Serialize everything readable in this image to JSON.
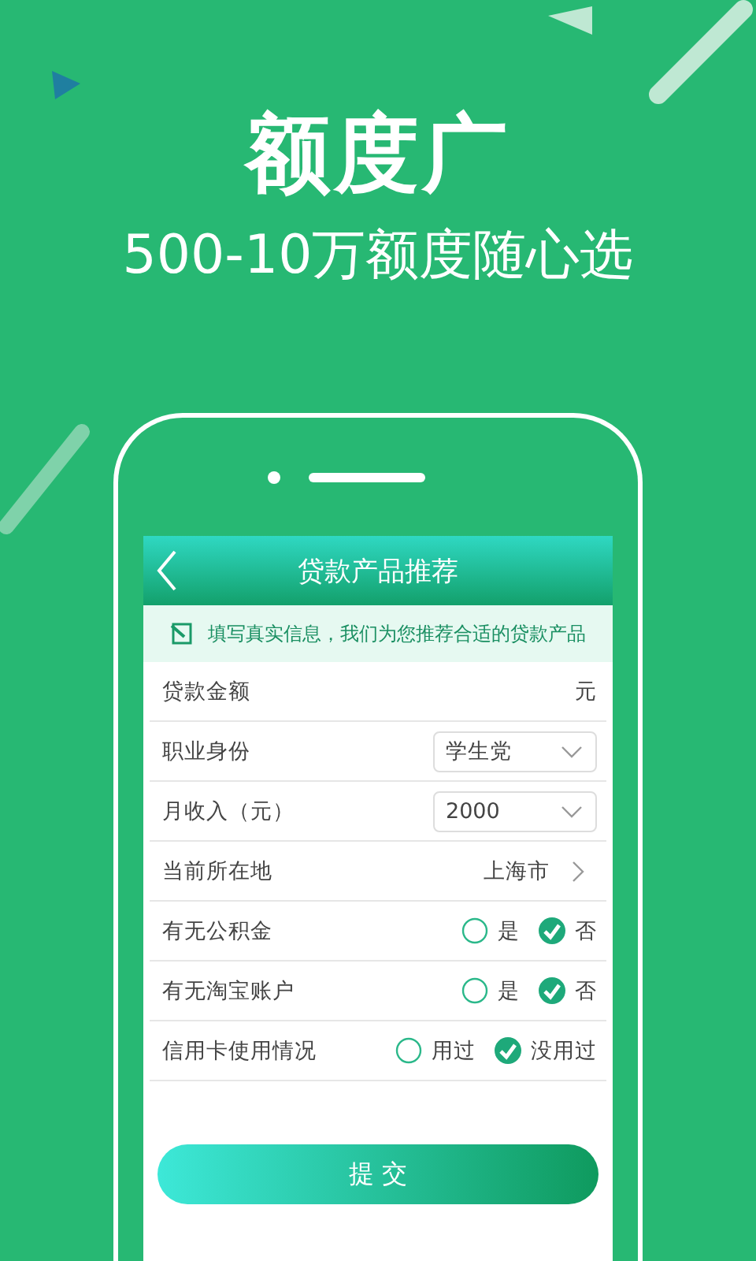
{
  "headline": "额度广",
  "subtitle": "500-10万额度随心选",
  "screen": {
    "title": "贷款产品推荐",
    "notice": "填写真实信息，我们为您推荐合适的贷款产品",
    "fields": [
      {
        "kind": "text",
        "label": "贷款金额",
        "unit": "元"
      },
      {
        "kind": "select",
        "label": "职业身份",
        "value": "学生党"
      },
      {
        "kind": "select",
        "label": "月收入（元）",
        "value": "2000"
      },
      {
        "kind": "link",
        "label": "当前所在地",
        "value": "上海市"
      },
      {
        "kind": "radio",
        "label": "有无公积金",
        "options": [
          {
            "label": "是",
            "selected": false
          },
          {
            "label": "否",
            "selected": true
          }
        ]
      },
      {
        "kind": "radio",
        "label": "有无淘宝账户",
        "options": [
          {
            "label": "是",
            "selected": false
          },
          {
            "label": "否",
            "selected": true
          }
        ]
      },
      {
        "kind": "radio",
        "label": "信用卡使用情况",
        "options": [
          {
            "label": "用过",
            "selected": false
          },
          {
            "label": "没用过",
            "selected": true
          }
        ]
      }
    ],
    "submit": "提 交"
  }
}
